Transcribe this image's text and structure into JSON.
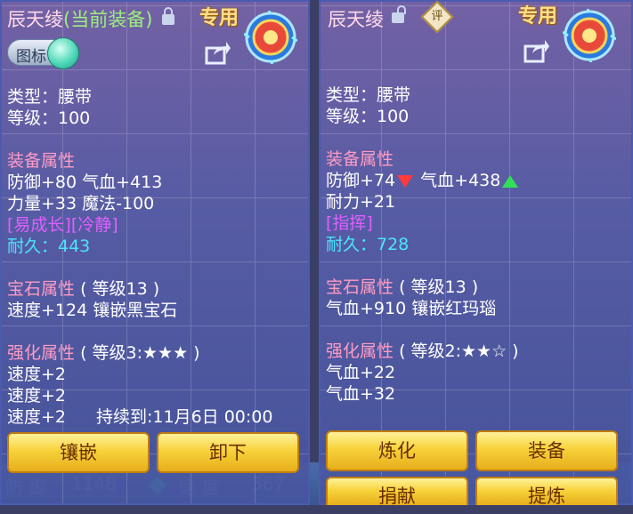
{
  "background": {
    "stat_left": "防 御",
    "stat_left_value": "1148",
    "stat_right": "速 度",
    "stat_right_value": "367"
  },
  "left": {
    "name": "辰天绫",
    "equipped_tag": "(当前装备)",
    "special": "专用",
    "icon_toggle_label": "图标",
    "type": "类型：腰带",
    "level": "等级：100",
    "attr_header": "装备属性",
    "attr_line1": "防御+80 气血+413",
    "attr_line2": "力量+33 魔法-100",
    "traits": "[易成长][冷静]",
    "durability": "耐久：443",
    "gem_header": "宝石属性",
    "gem_level": "( 等级13 )",
    "gem_line": "速度+124 镶嵌黑宝石",
    "enh_header": "强化属性",
    "enh_level": "( 等级3:★★★ )",
    "enh_line1": "速度+2",
    "enh_line2": "速度+2",
    "enh_line3": "速度+2",
    "expire": "持续到:11月6日 00:00",
    "btn_inlay": "镶嵌",
    "btn_remove": "卸下"
  },
  "right": {
    "name": "辰天绫",
    "special": "专用",
    "rate_label": "评",
    "type": "类型：腰带",
    "level": "等级：100",
    "attr_header": "装备属性",
    "attr_def": "防御+74",
    "attr_hp": "气血+438",
    "attr_line2": "耐力+21",
    "traits": "[指挥]",
    "durability": "耐久：728",
    "gem_header": "宝石属性",
    "gem_level": "( 等级13 )",
    "gem_line": "气血+910 镶嵌红玛瑙",
    "enh_header": "强化属性",
    "enh_level": "( 等级2:★★☆ )",
    "enh_line1": "气血+22",
    "enh_line2": "气血+32",
    "btn_refine": "炼化",
    "btn_equip": "装备",
    "btn_donate": "捐献",
    "btn_extract": "提炼"
  }
}
